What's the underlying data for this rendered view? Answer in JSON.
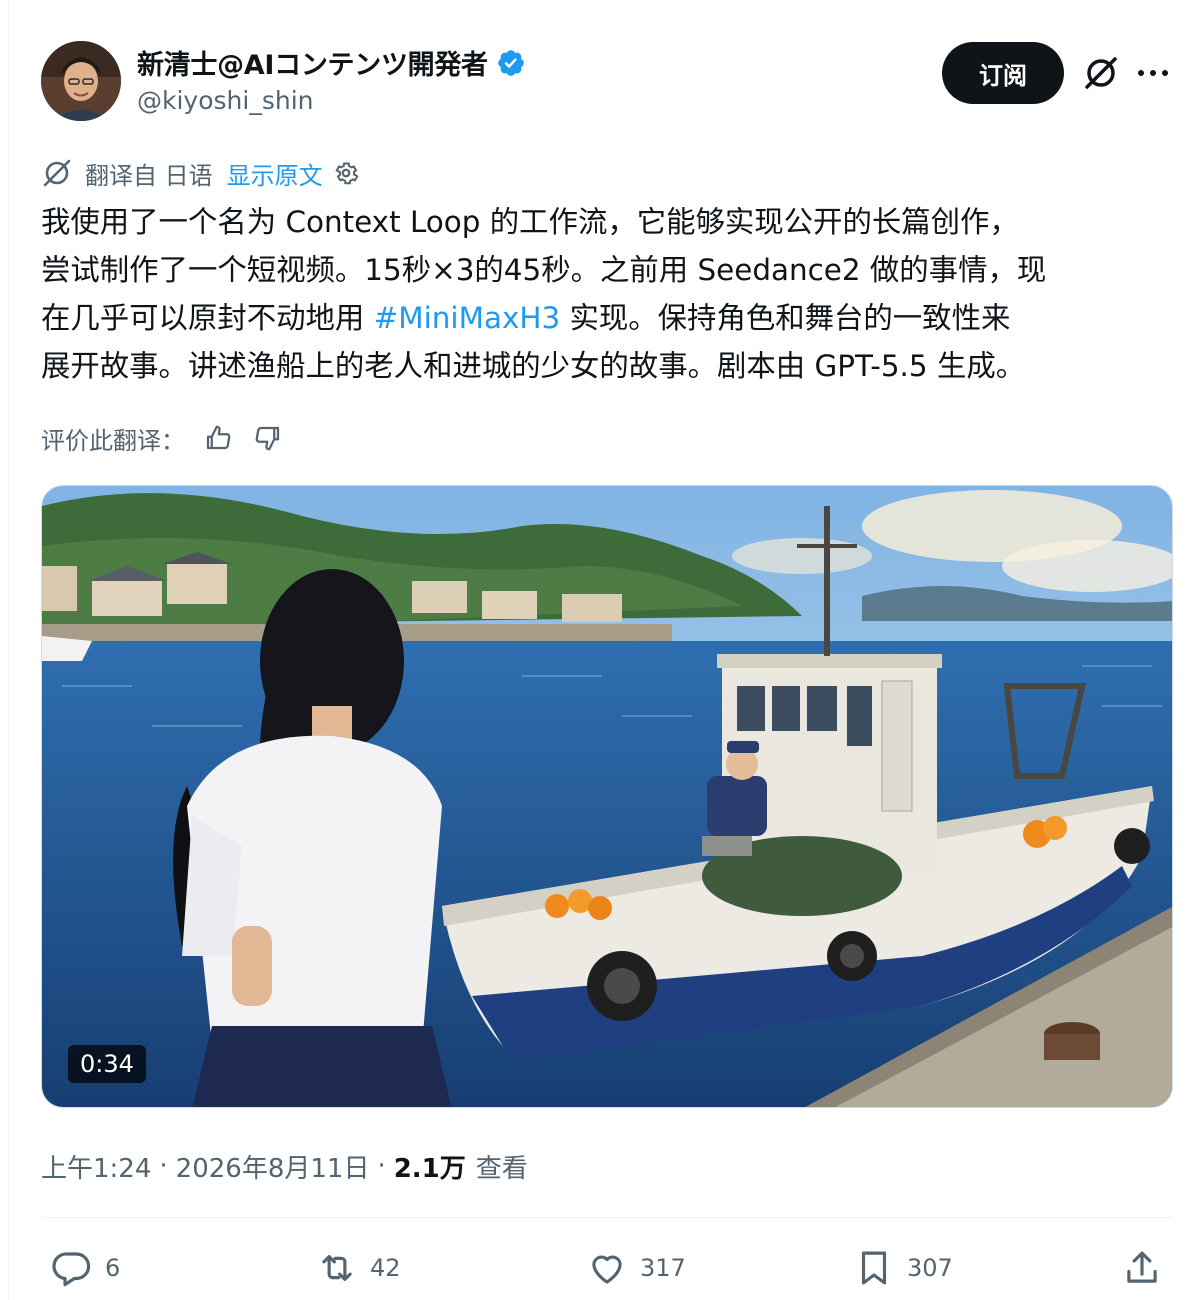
{
  "author": {
    "display_name": "新清士@AIコンテンツ開発者",
    "handle": "@kiyoshi_shin"
  },
  "header": {
    "subscribe_label": "订阅",
    "grok_icon": "grok-icon",
    "more_icon": "more-icon"
  },
  "translation": {
    "from_label": "翻译自 日语",
    "show_original": "显示原文"
  },
  "tweet": {
    "line1": "我使用了一个名为 Context Loop 的工作流，它能够实现公开的长篇创作，",
    "line2": "尝试制作了一个短视频。15秒×3的45秒。之前用 Seedance2 做的事情，现",
    "line3_before": "在几乎可以原封不动地用 ",
    "hashtag": "#MiniMaxH3",
    "line3_after": " 实现。保持角色和舞台的一致性来",
    "line4": "展开故事。讲述渔船上的老人和进城的少女的故事。剧本由 GPT-5.5 生成。"
  },
  "rate": {
    "label": "评价此翻译："
  },
  "media": {
    "duration": "0:34"
  },
  "meta": {
    "time": "上午1:24",
    "date": "2026年8月11日",
    "views_count": "2.1万",
    "views_label": "查看"
  },
  "actions": {
    "replies": "6",
    "reposts": "42",
    "likes": "317",
    "bookmarks": "307"
  },
  "colors": {
    "accent": "#1d9bf0",
    "text_primary": "#0f1419",
    "text_secondary": "#536471"
  }
}
